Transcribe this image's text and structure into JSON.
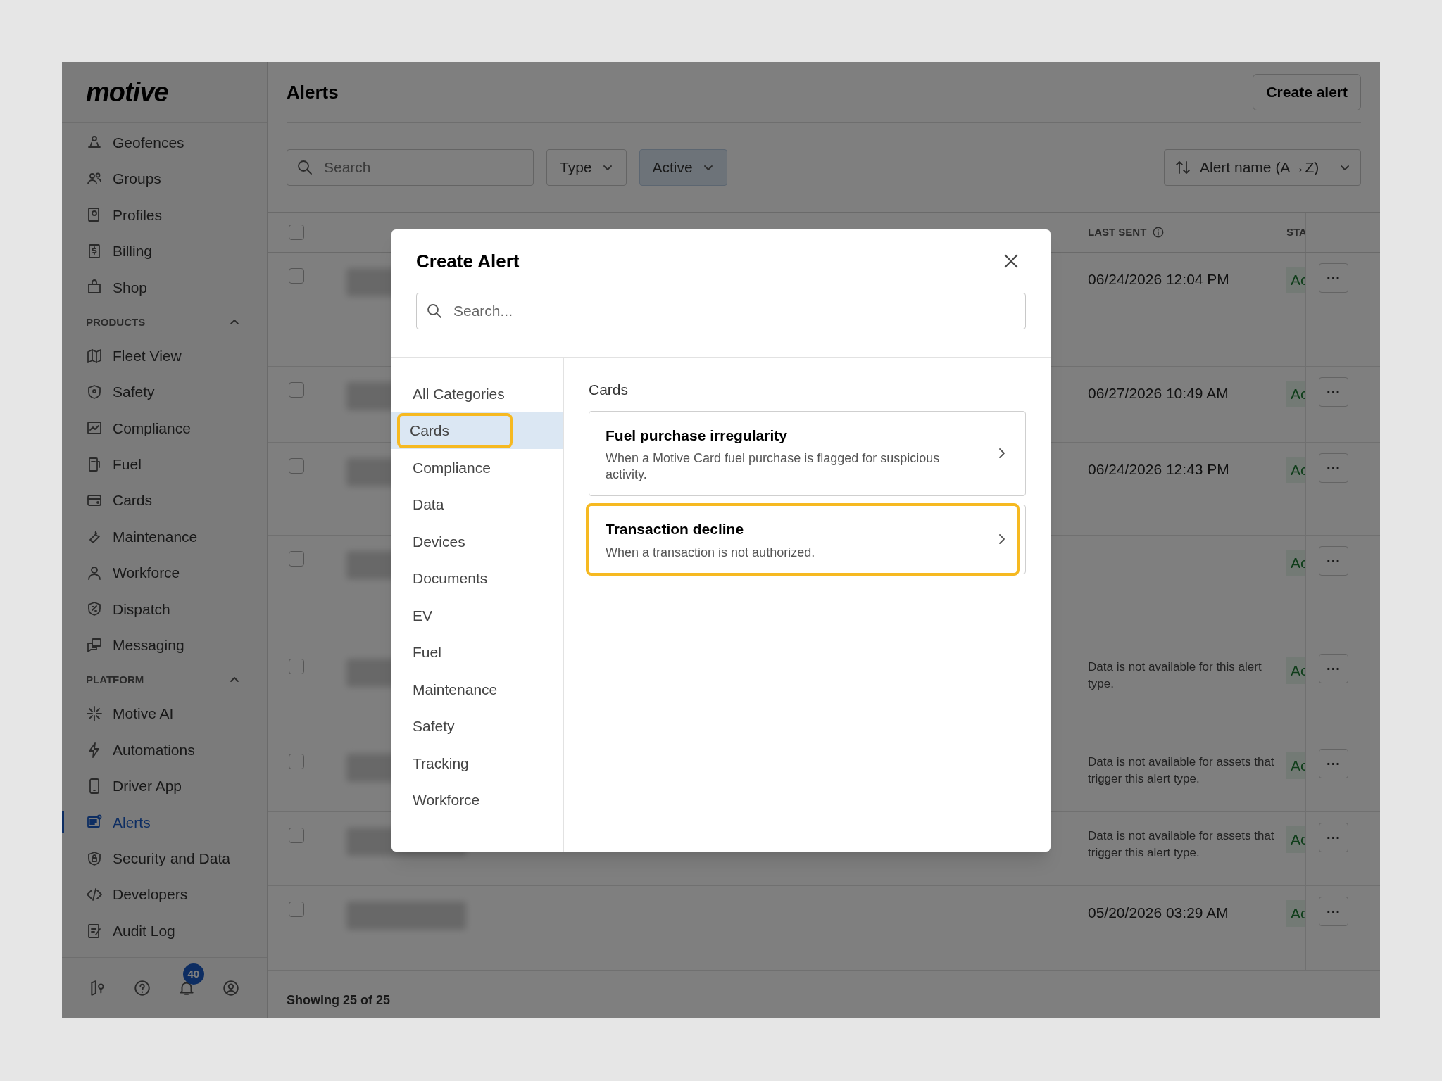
{
  "logo": "motive",
  "sidebar": {
    "items": [
      {
        "label": "Geofences",
        "selected": false
      },
      {
        "label": "Groups",
        "selected": false
      },
      {
        "label": "Profiles",
        "selected": false
      },
      {
        "label": "Billing",
        "selected": false
      },
      {
        "label": "Shop",
        "selected": false
      }
    ],
    "sections": [
      {
        "title": "PRODUCTS",
        "expanded": true,
        "items": [
          {
            "label": "Fleet View",
            "selected": false
          },
          {
            "label": "Safety",
            "selected": false
          },
          {
            "label": "Compliance",
            "selected": false
          },
          {
            "label": "Fuel",
            "selected": false
          },
          {
            "label": "Cards",
            "selected": false
          },
          {
            "label": "Maintenance",
            "selected": false
          },
          {
            "label": "Workforce",
            "selected": false
          },
          {
            "label": "Dispatch",
            "selected": false
          },
          {
            "label": "Messaging",
            "selected": false
          }
        ]
      },
      {
        "title": "PLATFORM",
        "expanded": true,
        "items": [
          {
            "label": "Motive AI",
            "selected": false
          },
          {
            "label": "Automations",
            "selected": false
          },
          {
            "label": "Driver App",
            "selected": false
          },
          {
            "label": "Alerts",
            "selected": true
          },
          {
            "label": "Security and Data",
            "selected": false
          },
          {
            "label": "Developers",
            "selected": false
          },
          {
            "label": "Audit Log",
            "selected": false
          }
        ]
      }
    ],
    "notification_count": "40"
  },
  "page": {
    "title": "Alerts",
    "create_button": "Create alert",
    "search": {
      "placeholder": "Search"
    },
    "filters": [
      {
        "label": "Type",
        "active": false
      },
      {
        "label": "Active",
        "active": true
      }
    ],
    "sort": "Alert name (A→Z)"
  },
  "table": {
    "columns": [
      {
        "label": "LAST SENT"
      },
      {
        "label": "STA"
      }
    ],
    "select_all_checked": false,
    "rows": [
      {
        "checked": false,
        "last_sent": "06/24/2026 12:04 PM",
        "status": "Ac"
      },
      {
        "checked": false,
        "last_sent": "06/27/2026 10:49 AM",
        "status": "Ac"
      },
      {
        "checked": false,
        "last_sent": "06/24/2026 12:43 PM",
        "status": "Ac"
      },
      {
        "checked": false,
        "status": "Ac"
      },
      {
        "checked": false,
        "last_sent": "Data is not available for this alert type.",
        "status": "Ac"
      },
      {
        "checked": false,
        "last_sent": "Data is not available for assets that trigger this alert type.",
        "status": "Ac"
      },
      {
        "checked": false,
        "last_sent": "Data is not available for assets that trigger this alert type.",
        "status": "Ac"
      },
      {
        "checked": false,
        "last_sent": "05/20/2026 03:29 AM",
        "status": "Ac"
      }
    ],
    "more_label": "···",
    "footer": "Showing 25 of 25"
  },
  "dialog": {
    "title": "Create Alert",
    "search": {
      "placeholder": "Search..."
    },
    "categories": [
      {
        "label": "All Categories",
        "selected": false,
        "highlighted": false
      },
      {
        "label": "Cards",
        "selected": true,
        "highlighted": true
      },
      {
        "label": "Compliance",
        "selected": false,
        "highlighted": false
      },
      {
        "label": "Data",
        "selected": false,
        "highlighted": false
      },
      {
        "label": "Devices",
        "selected": false,
        "highlighted": false
      },
      {
        "label": "Documents",
        "selected": false,
        "highlighted": false
      },
      {
        "label": "EV",
        "selected": false,
        "highlighted": false
      },
      {
        "label": "Fuel",
        "selected": false,
        "highlighted": false
      },
      {
        "label": "Maintenance",
        "selected": false,
        "highlighted": false
      },
      {
        "label": "Safety",
        "selected": false,
        "highlighted": false
      },
      {
        "label": "Tracking",
        "selected": false,
        "highlighted": false
      },
      {
        "label": "Workforce",
        "selected": false,
        "highlighted": false
      }
    ],
    "section_title": "Cards",
    "alerts": [
      {
        "title": "Fuel purchase irregularity",
        "description": "When a Motive Card fuel purchase is flagged for suspicious activity.",
        "highlighted": false
      },
      {
        "title": "Transaction decline",
        "description": "When a transaction is not authorized.",
        "highlighted": true
      }
    ]
  }
}
